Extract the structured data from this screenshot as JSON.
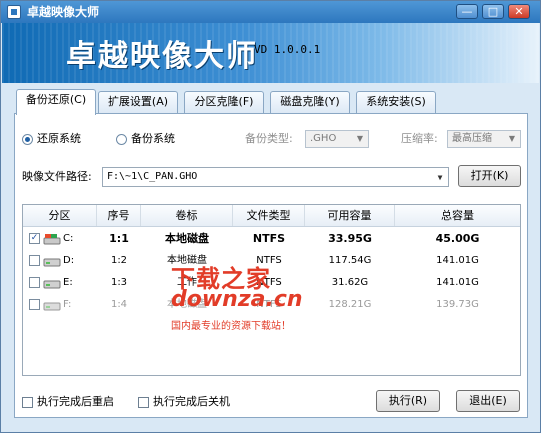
{
  "window": {
    "title": "卓越映像大师",
    "controls": {
      "minimize": "—",
      "maximize": "□",
      "close": "✕"
    }
  },
  "banner": {
    "title": "卓越映像大师",
    "version": "VD 1.0.0.1"
  },
  "tabs": [
    {
      "label": "备份还原(C)",
      "active": true
    },
    {
      "label": "扩展设置(A)",
      "active": false
    },
    {
      "label": "分区克隆(F)",
      "active": false
    },
    {
      "label": "磁盘克隆(Y)",
      "active": false
    },
    {
      "label": "系统安装(S)",
      "active": false
    }
  ],
  "options": {
    "restore_label": "还原系统",
    "backup_label": "备份系统",
    "backup_type_label": "备份类型:",
    "backup_type_value": ".GHO",
    "compression_label": "压缩率:",
    "compression_value": "最高压缩"
  },
  "image_path": {
    "label": "映像文件路径:",
    "value": "F:\\~1\\C_PAN.GHO",
    "open_button": "打开(K)"
  },
  "table": {
    "columns": [
      "分区",
      "序号",
      "卷标",
      "文件类型",
      "可用容量",
      "总容量"
    ],
    "rows": [
      {
        "checked": true,
        "drive": "C:",
        "index": "1:1",
        "label": "本地磁盘",
        "fs": "NTFS",
        "free": "33.95G",
        "total": "45.00G"
      },
      {
        "checked": false,
        "drive": "D:",
        "index": "1:2",
        "label": "本地磁盘",
        "fs": "NTFS",
        "free": "117.54G",
        "total": "141.01G"
      },
      {
        "checked": false,
        "drive": "E:",
        "index": "1:3",
        "label": "工作",
        "fs": "NTFS",
        "free": "31.62G",
        "total": "141.01G"
      },
      {
        "checked": false,
        "drive": "F:",
        "index": "1:4",
        "label": "本地磁盘",
        "fs": "NTFS",
        "free": "128.21G",
        "total": "139.73G"
      }
    ]
  },
  "watermark": {
    "main": "下载之家",
    "sub": "downza.cn",
    "tag": "国内最专业的资源下载站！"
  },
  "footer": {
    "restart_after": "执行完成后重启",
    "shutdown_after": "执行完成后关机",
    "execute_button": "执行(R)",
    "exit_button": "退出(E)"
  }
}
